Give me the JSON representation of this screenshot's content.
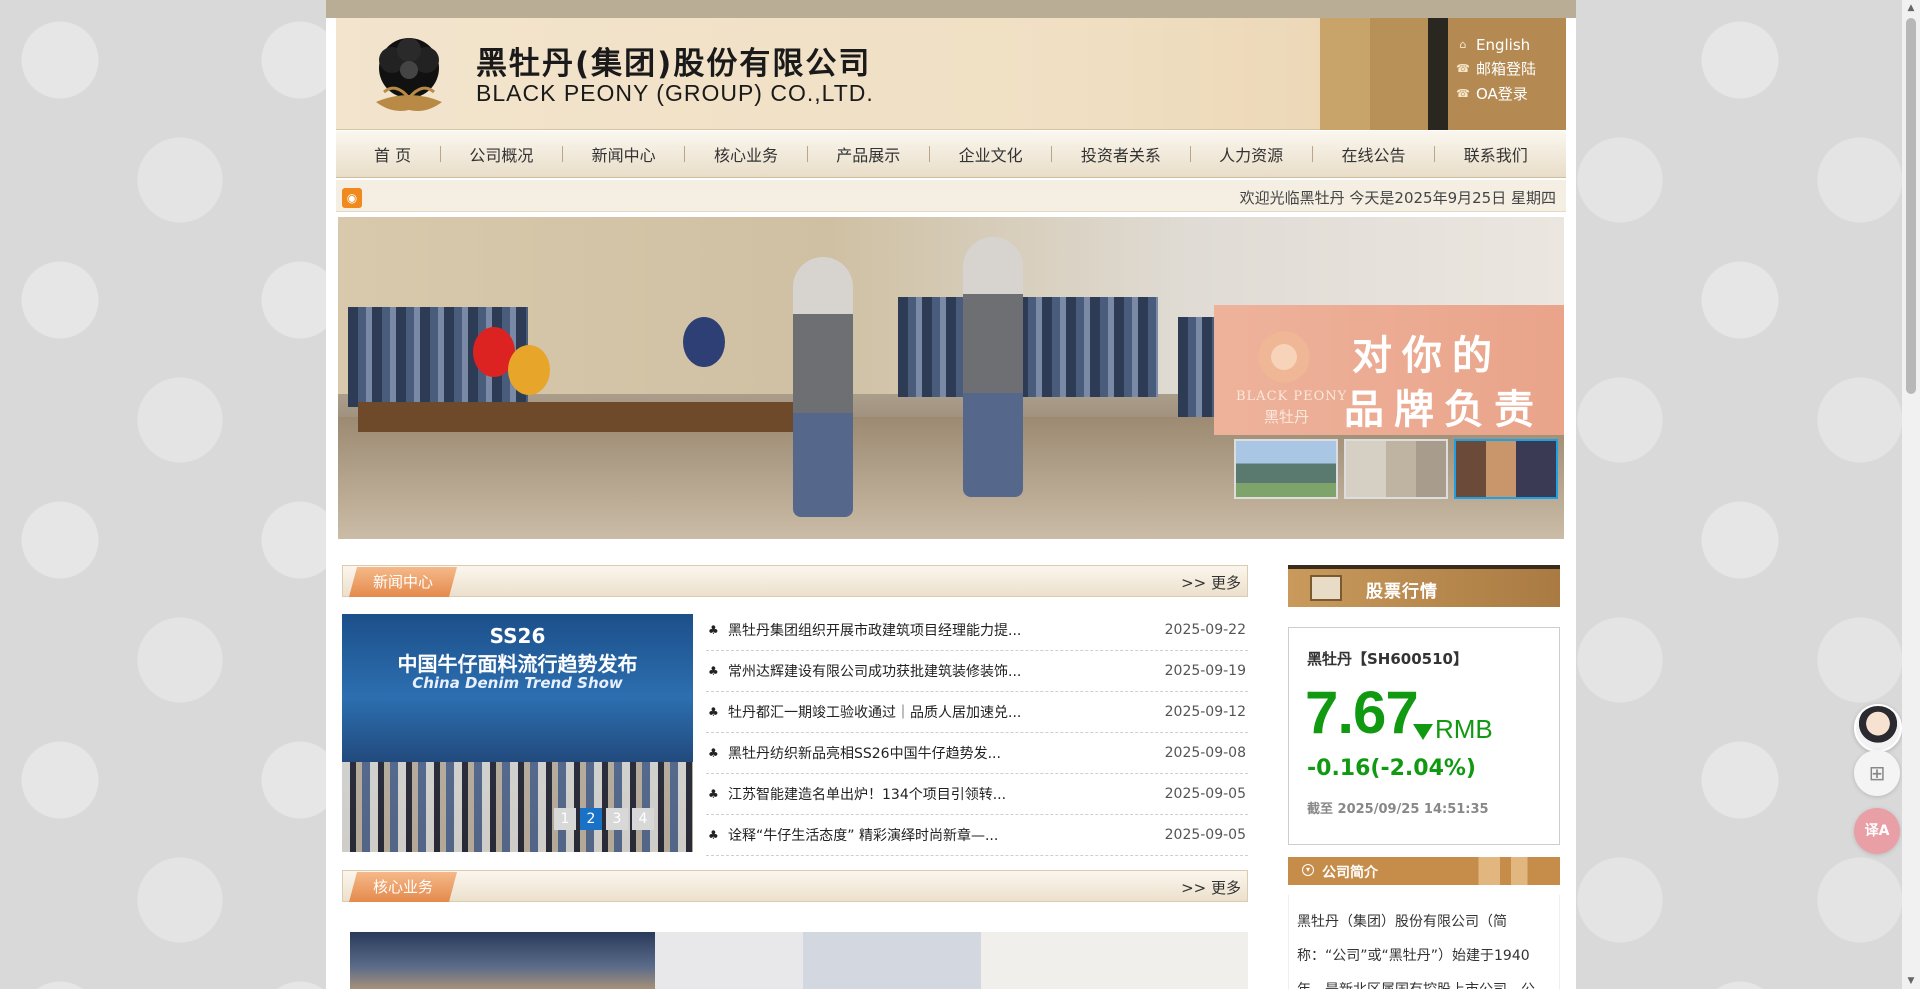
{
  "header": {
    "brand_cn": "黑牡丹(集团)股份有限公司",
    "brand_en": "BLACK PEONY (GROUP) CO.,LTD.",
    "links": [
      {
        "label": "English",
        "icon": "home-icon"
      },
      {
        "label": "邮箱登陆",
        "icon": "phone-icon"
      },
      {
        "label": "OA登录",
        "icon": "phone-icon"
      }
    ]
  },
  "nav": {
    "items": [
      "首 页",
      "公司概况",
      "新闻中心",
      "核心业务",
      "产品展示",
      "企业文化",
      "投资者关系",
      "人力资源",
      "在线公告",
      "联系我们"
    ]
  },
  "infobar": {
    "welcome": "欢迎光临黑牡丹 今天是2025年9月25日 星期四"
  },
  "banner": {
    "bp_en": "BLACK PEONY",
    "bp_cn": "黑牡丹",
    "slogan_line1": "对你的",
    "slogan_line2": "品牌负责",
    "active_thumb": 3
  },
  "news": {
    "section_title": "新闻中心",
    "more": ">> 更多",
    "image_title1": "SS26",
    "image_title2": "中国牛仔面料流行趋势发布",
    "image_title3": "China Denim Trend Show",
    "pager": [
      "1",
      "2",
      "3",
      "4"
    ],
    "active_page": 2,
    "items": [
      {
        "title": "黑牡丹集团组织开展市政建筑项目经理能力提...",
        "date": "2025-09-22"
      },
      {
        "title": "常州达辉建设有限公司成功获批建筑装修装饰...",
        "date": "2025-09-19"
      },
      {
        "title": "牡丹都汇一期竣工验收通过｜品质人居加速兑...",
        "date": "2025-09-12"
      },
      {
        "title": "黑牡丹纺织新品亮相SS26中国牛仔趋势发...",
        "date": "2025-09-08"
      },
      {
        "title": "江苏智能建造名单出炉！134个项目引领转...",
        "date": "2025-09-05"
      },
      {
        "title": "诠释“牛仔生活态度” 精彩演绎时尚新章—...",
        "date": "2025-09-05"
      }
    ]
  },
  "core": {
    "section_title": "核心业务",
    "more": ">> 更多"
  },
  "stock": {
    "section_title": "股票行情",
    "name": "黑牡丹【SH600510】",
    "price": "7.67",
    "unit": "RMB",
    "change": "-0.16(-2.04%)",
    "time": "截至 2025/09/25 14:51:35",
    "color": "#129912"
  },
  "intro": {
    "section_title": "公司简介",
    "text": "黑牡丹（集团）股份有限公司（简称：“公司”或“黑牡丹”）始建于1940年，是新北区属国有控股上市公司，公"
  },
  "floating": {
    "translate_label": "译A"
  }
}
